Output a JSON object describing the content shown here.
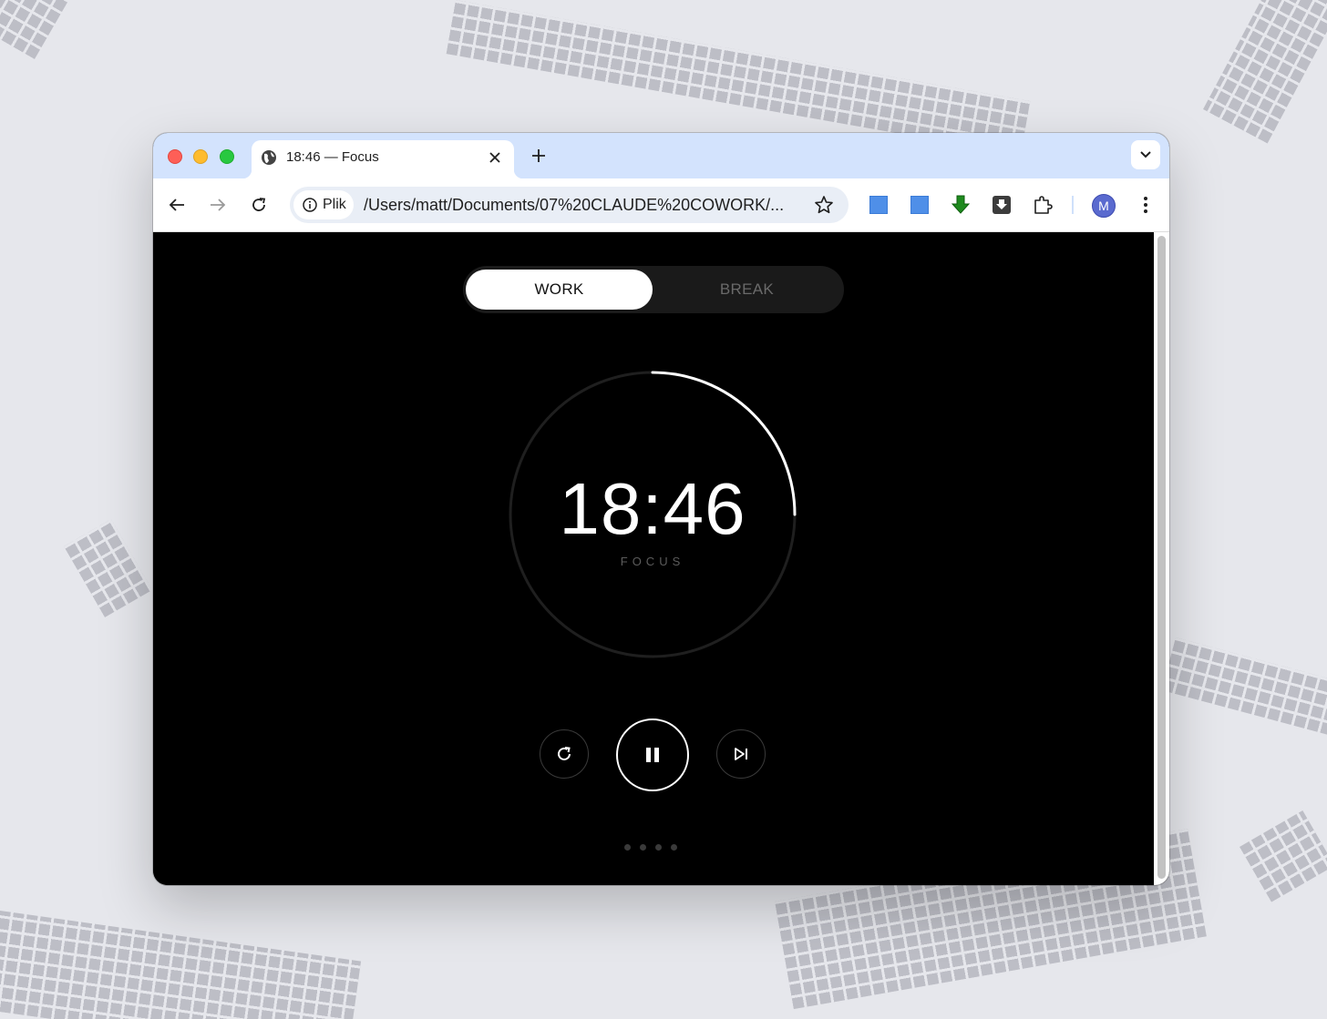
{
  "browser": {
    "tab_title": "18:46 — Focus",
    "new_tab_symbol": "+",
    "chip_label": "Plik",
    "url": "/Users/matt/Documents/07%20CLAUDE%20COWORK/...",
    "avatar_initial": "M"
  },
  "app": {
    "modes": [
      "WORK",
      "BREAK"
    ],
    "active_mode": "WORK",
    "time": "18:46",
    "phase_label": "FOCUS",
    "progress_fraction": 0.25,
    "session_dots": 4
  },
  "colors": {
    "accent": "#ffffff",
    "background": "#000000",
    "ring_track": "#1f1f1f"
  }
}
